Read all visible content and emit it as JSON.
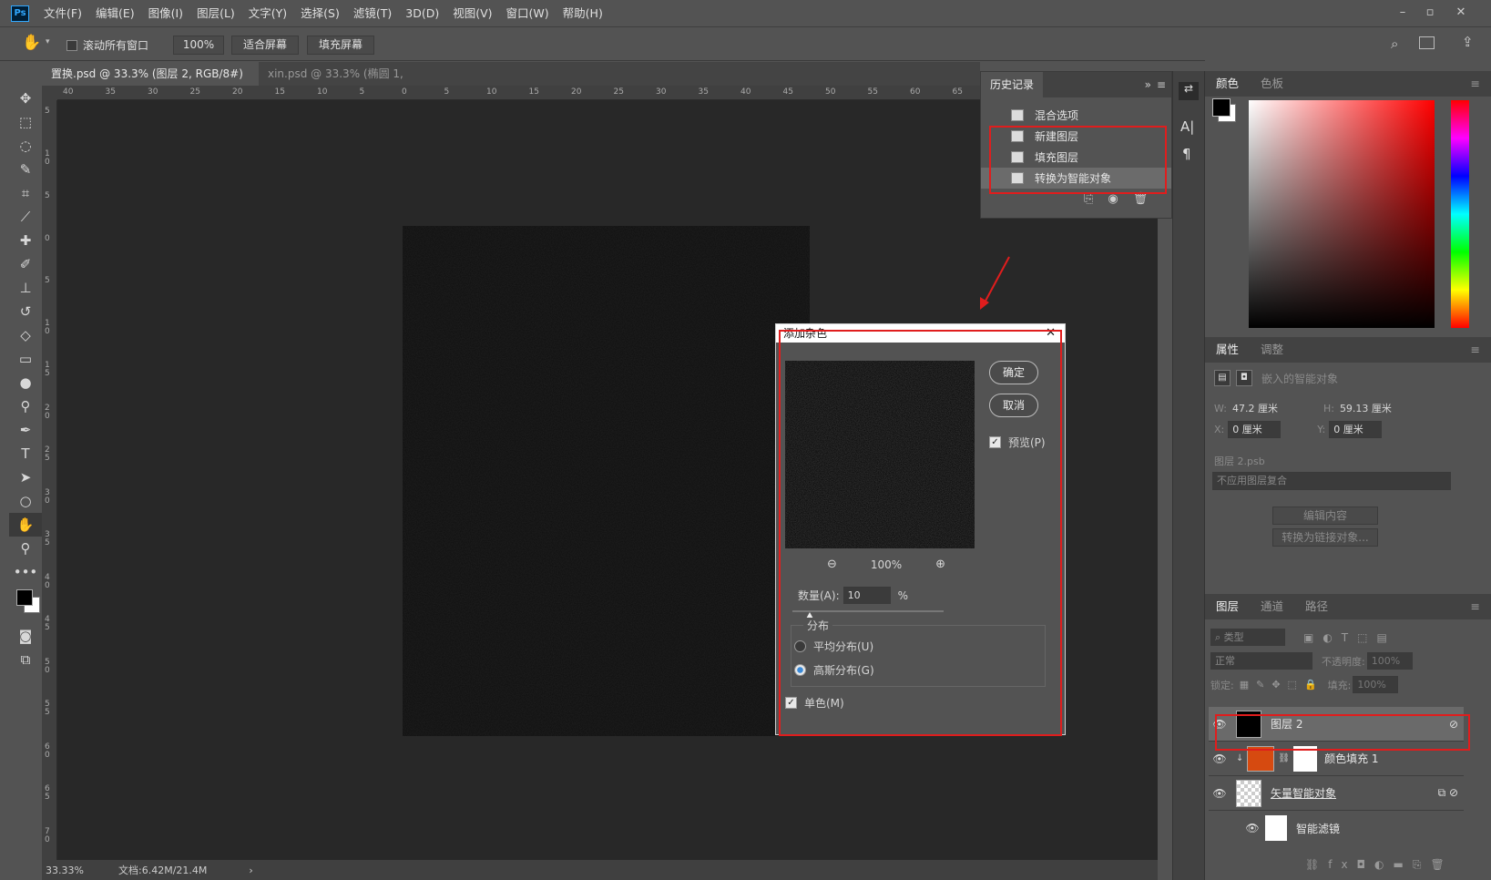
{
  "app": {
    "logo": "Ps"
  },
  "menu": [
    "文件(F)",
    "编辑(E)",
    "图像(I)",
    "图层(L)",
    "文字(Y)",
    "选择(S)",
    "滤镜(T)",
    "3D(D)",
    "视图(V)",
    "窗口(W)",
    "帮助(H)"
  ],
  "options": {
    "scroll_all": "滚动所有窗口",
    "zoom": "100%",
    "fit": "适合屏幕",
    "fill": "填充屏幕"
  },
  "tabs": [
    {
      "label": "置换.psd @ 33.3% (图层 2, RGB/8#) *",
      "close": "×"
    },
    {
      "label": "xin.psd @ 33.3% (椭圆 1, RGB/8) *",
      "close": "×"
    }
  ],
  "ruler_ticks": [
    "40",
    "35",
    "30",
    "25",
    "20",
    "15",
    "10",
    "5",
    "0",
    "5",
    "10",
    "15",
    "20",
    "25",
    "30",
    "35",
    "40",
    "45",
    "50",
    "55",
    "60",
    "65"
  ],
  "ruler_left": [
    "5",
    "1\n0",
    "5",
    "0",
    "5",
    "1\n0",
    "1\n5",
    "2\n0",
    "2\n5",
    "3\n0",
    "3\n5",
    "4\n0",
    "4\n5",
    "5\n0",
    "5\n5",
    "6\n0",
    "6\n5",
    "7\n0"
  ],
  "status": {
    "zoom": "33.33%",
    "doc": "文档:6.42M/21.4M",
    "arrow": "›"
  },
  "history": {
    "title": "历史记录",
    "items": [
      "混合选项",
      "新建图层",
      "填充图层",
      "转换为智能对象"
    ],
    "selected": 3
  },
  "color": {
    "tabs": [
      "颜色",
      "色板"
    ]
  },
  "properties": {
    "tabs": [
      "属性",
      "调整"
    ],
    "subtitle": "嵌入的智能对象",
    "w_label": "W:",
    "w": "47.2 厘米",
    "h_label": "H:",
    "h": "59.13 厘米",
    "x_label": "X:",
    "x": "0 厘米",
    "y_label": "Y:",
    "y": "0 厘米",
    "file": "图层 2.psb",
    "comp": "不应用图层复合",
    "edit": "编辑内容",
    "convert": "转换为链接对象..."
  },
  "layers_panel": {
    "tabs": [
      "图层",
      "通道",
      "路径"
    ],
    "filter": "类型",
    "blend": "正常",
    "opacity_label": "不透明度:",
    "opacity": "100%",
    "lock_label": "锁定:",
    "fill_label": "填充:",
    "fill": "100%",
    "layers": [
      {
        "name": "图层 2"
      },
      {
        "name": "颜色填充 1"
      },
      {
        "name": "矢量智能对象"
      },
      {
        "name": "智能滤镜"
      }
    ]
  },
  "dialog": {
    "title": "添加杂色",
    "ok": "确定",
    "cancel": "取消",
    "preview": "预览(P)",
    "zoom": "100%",
    "amount_label": "数量(A):",
    "amount": "10",
    "pct": "%",
    "dist_label": "分布",
    "uniform": "平均分布(U)",
    "gaussian": "高斯分布(G)",
    "mono": "单色(M)"
  },
  "colors": {
    "accent_red": "#e01d1d",
    "fill_orange": "#d64a10"
  }
}
